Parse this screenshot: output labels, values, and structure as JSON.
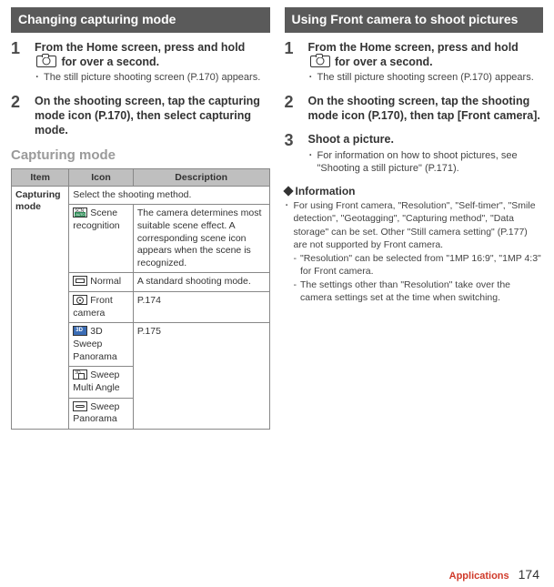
{
  "left": {
    "heading": "Changing capturing mode",
    "step1_num": "1",
    "step1_before": "From the Home screen, press and hold ",
    "step1_after": " for over a second.",
    "step1_bullet": "The still picture shooting screen (P.170) appears.",
    "step2_num": "2",
    "step2_text": "On the shooting screen, tap the capturing mode icon (P.170), then select capturing mode.",
    "subheading": "Capturing mode",
    "table": {
      "headers": {
        "item": "Item",
        "icon": "Icon",
        "desc": "Description"
      },
      "row_label": "Capturing mode",
      "row_span_text": "Select the shooting method.",
      "rows": [
        {
          "icon_label": "Scene recognition",
          "desc": "The camera determines most suitable scene effect. A corresponding scene icon appears when the scene is recognized."
        },
        {
          "icon_label": "Normal",
          "desc": "A standard shooting mode."
        },
        {
          "icon_label": "Front camera",
          "desc": "P.174"
        },
        {
          "icon_label": "3D Sweep Panorama",
          "desc": "P.175"
        },
        {
          "icon_label": "Sweep Multi Angle",
          "desc": ""
        },
        {
          "icon_label": "Sweep Panorama",
          "desc": ""
        }
      ]
    }
  },
  "right": {
    "heading": "Using Front camera to shoot pictures",
    "step1_num": "1",
    "step1_before": "From the Home screen, press and hold ",
    "step1_after": " for over a second.",
    "step1_bullet": "The still picture shooting screen (P.170) appears.",
    "step2_num": "2",
    "step2_text": "On the shooting screen, tap the shooting mode icon (P.170), then tap [Front camera].",
    "step3_num": "3",
    "step3_title": "Shoot a picture.",
    "step3_bullet": "For information on how to shoot pictures, see \"Shooting a still picture\" (P.171).",
    "info_heading": "Information",
    "info_main": "For using Front camera, \"Resolution\", \"Self-timer\", \"Smile detection\", \"Geotagging\", \"Capturing method\", \"Data storage\" can be set. Other \"Still camera setting\" (P.177) are not supported by Front camera.",
    "info_sub1": "\"Resolution\" can be selected from \"1MP 16:9\", \"1MP 4:3\" for Front camera.",
    "info_sub2": "The settings other than \"Resolution\" take over the camera settings set at the time when switching."
  },
  "footer": {
    "section": "Applications",
    "page": "174"
  }
}
